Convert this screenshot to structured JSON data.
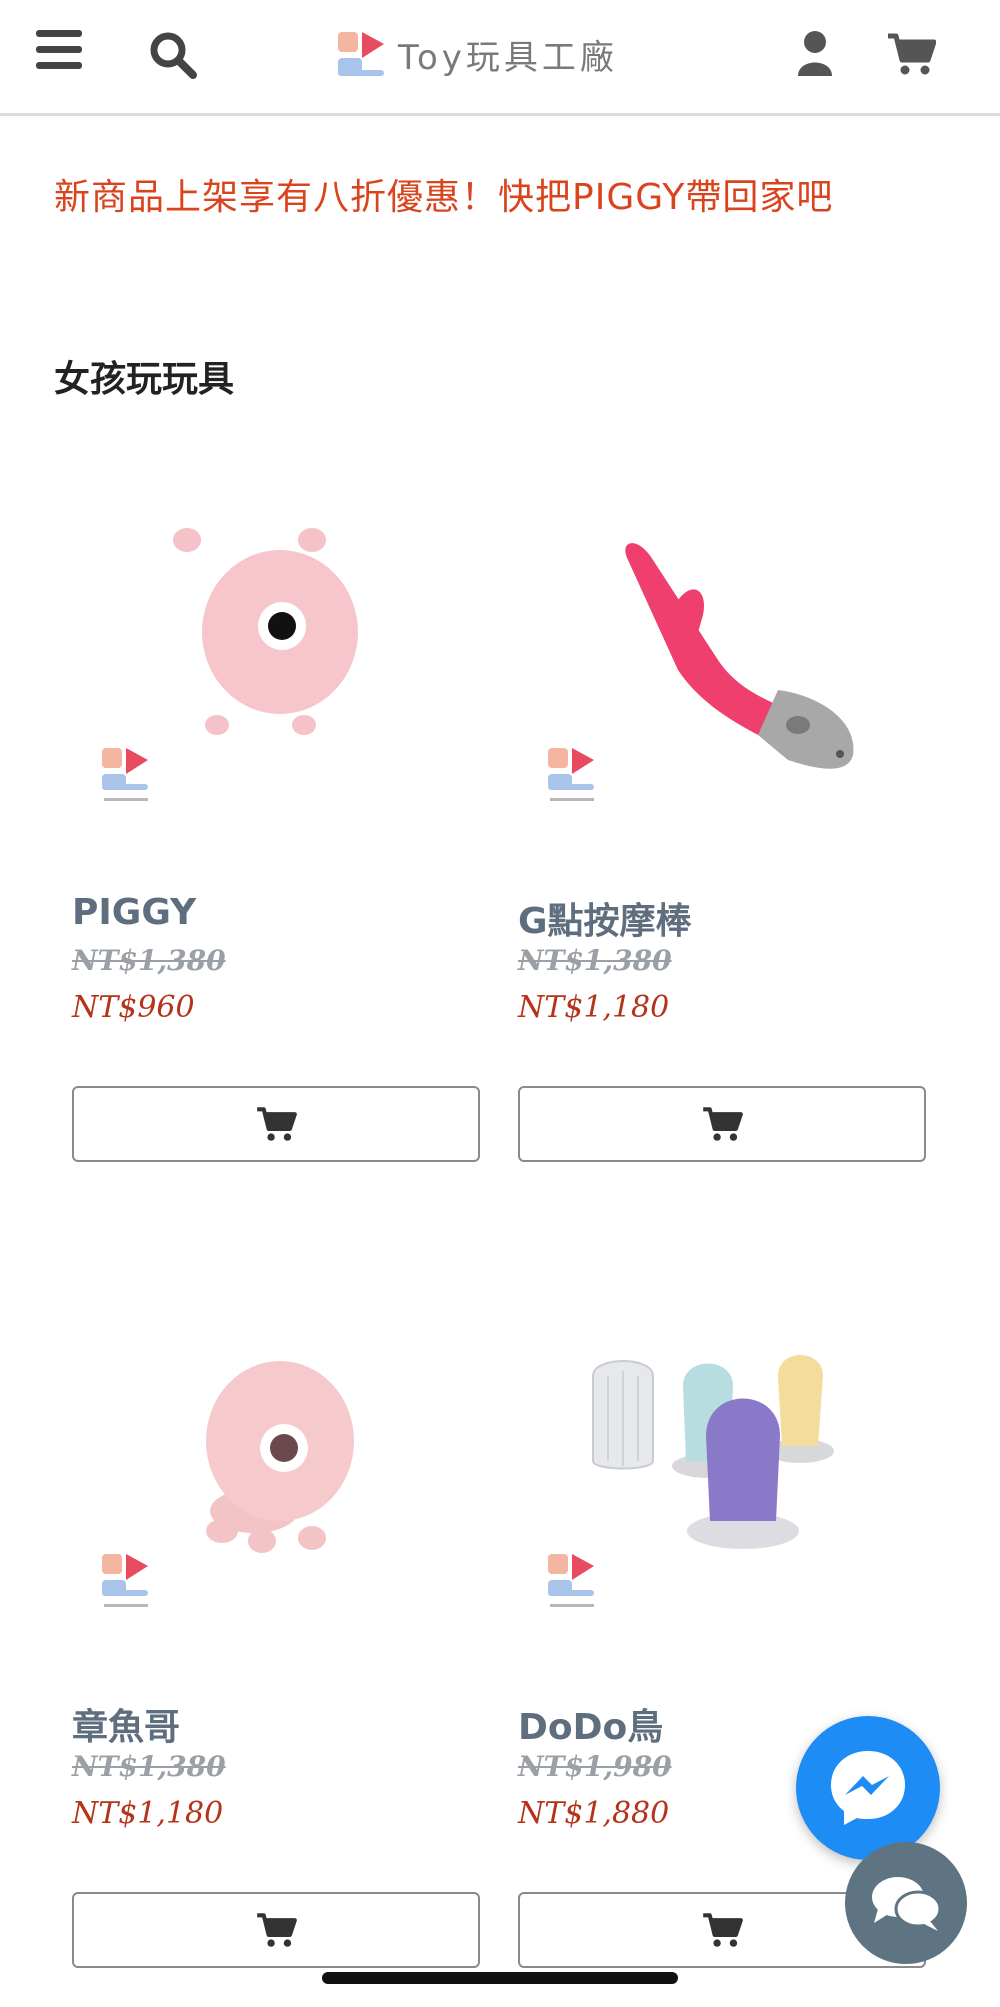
{
  "header": {
    "logo_text": "Toy玩具工廠",
    "menu_icon": "hamburger-icon",
    "search_icon": "search-icon",
    "account_icon": "user-icon",
    "cart_icon": "cart-icon"
  },
  "promo": {
    "text": "新商品上架享有八折優惠！快把PIGGY帶回家吧",
    "color": "#d9441c"
  },
  "section": {
    "title": "女孩玩玩具"
  },
  "products": [
    {
      "name": "PIGGY",
      "old_price": "NT$1,380",
      "price": "NT$960",
      "badge_text": "Toy玩具工廠"
    },
    {
      "name": "G點按摩棒",
      "old_price": "NT$1,380",
      "price": "NT$1,180",
      "badge_text": "Toy玩具工廠"
    },
    {
      "name": "章魚哥",
      "old_price": "NT$1,380",
      "price": "NT$1,180",
      "badge_text": "Toy玩具工廠"
    },
    {
      "name": "DoDo鳥",
      "old_price": "NT$1,980",
      "price": "NT$1,880",
      "badge_text": "Toy玩具工廠"
    }
  ],
  "floating": {
    "messenger_icon": "messenger-icon",
    "chat_icon": "chat-bubbles-icon"
  },
  "colors": {
    "price_red": "#b5331a",
    "name_slate": "#5f6e7e",
    "messenger_blue": "#1e8cf5",
    "chat_gray": "#5f7483"
  }
}
